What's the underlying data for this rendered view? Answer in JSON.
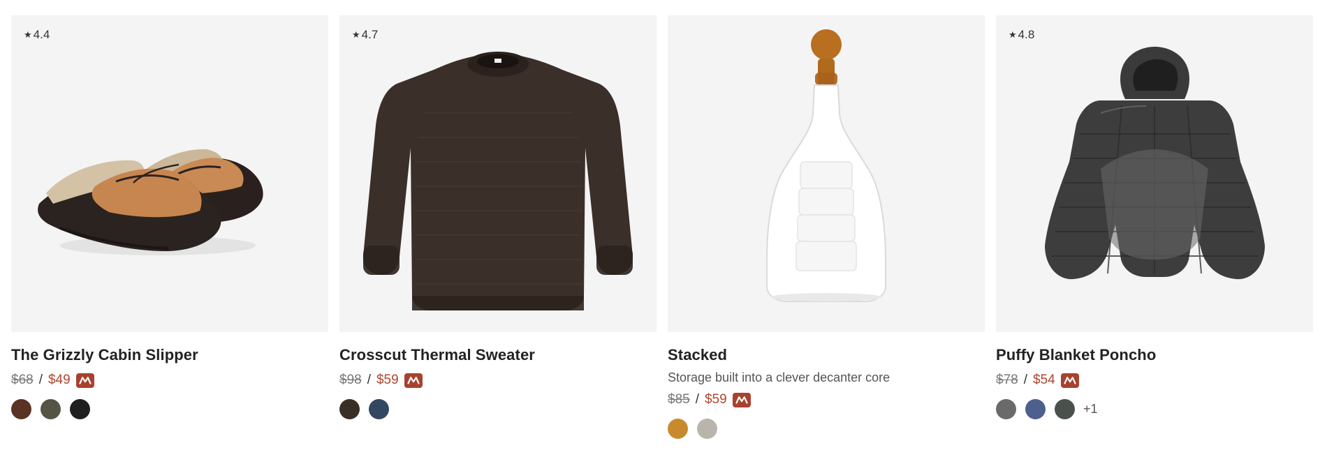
{
  "products": [
    {
      "rating": "4.4",
      "title": "The Grizzly Cabin Slipper",
      "subtitle": "",
      "price_old": "$68",
      "price_sep": "/",
      "price_new": "$49",
      "badge_icon": "m-logo-icon",
      "swatches": [
        "#5a3226",
        "#565444",
        "#1f1f1f"
      ],
      "extra_swatches": ""
    },
    {
      "rating": "4.7",
      "title": "Crosscut Thermal Sweater",
      "subtitle": "",
      "price_old": "$98",
      "price_sep": "/",
      "price_new": "$59",
      "badge_icon": "m-logo-icon",
      "swatches": [
        "#3a2f27",
        "#344760"
      ],
      "extra_swatches": ""
    },
    {
      "rating": "",
      "title": "Stacked",
      "subtitle": "Storage built into a clever decanter core",
      "price_old": "$85",
      "price_sep": "/",
      "price_new": "$59",
      "badge_icon": "m-logo-icon",
      "swatches": [
        "#c88a2c",
        "#b9b5ad"
      ],
      "extra_swatches": ""
    },
    {
      "rating": "4.8",
      "title": "Puffy Blanket Poncho",
      "subtitle": "",
      "price_old": "$78",
      "price_sep": "/",
      "price_new": "$54",
      "badge_icon": "m-logo-icon",
      "swatches": [
        "#6a6a6a",
        "#4e5f8d",
        "#4a504c"
      ],
      "extra_swatches": "+1"
    }
  ],
  "colors": {
    "sale_price": "#b1452f",
    "badge_bg": "#a8412f",
    "card_bg": "#f4f4f4"
  },
  "icons": {
    "star": "star-icon",
    "badge": "m-logo-icon"
  }
}
